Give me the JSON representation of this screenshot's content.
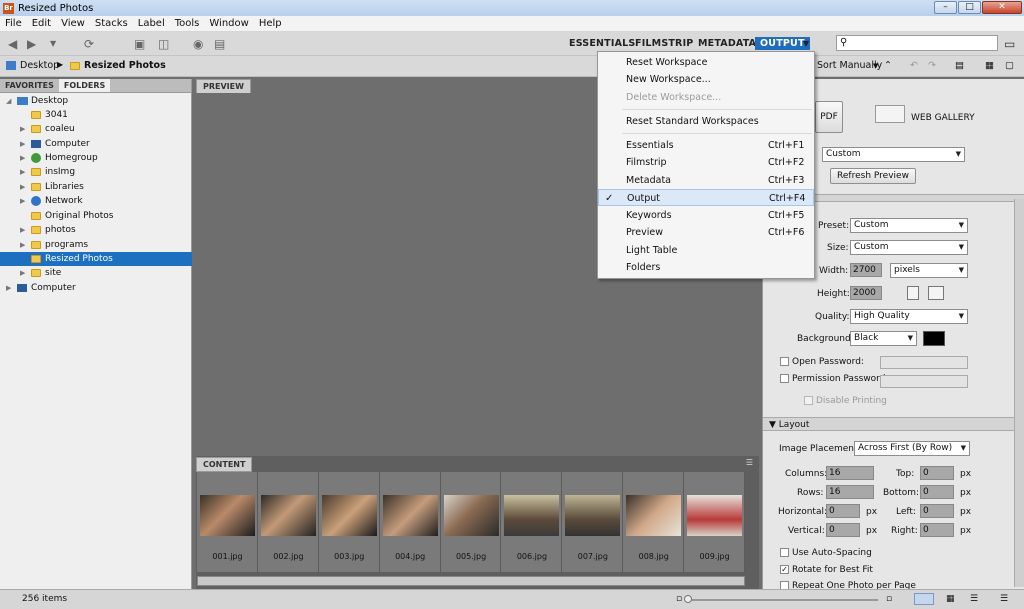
{
  "window": {
    "title": "Resized Photos",
    "app_badge": "Br",
    "controls": {
      "minimize": "–",
      "maximize": "□",
      "close": "✕"
    }
  },
  "menubar": [
    "File",
    "Edit",
    "View",
    "Stacks",
    "Label",
    "Tools",
    "Window",
    "Help"
  ],
  "workspaces": {
    "essentials": "ESSENTIALS",
    "filmstrip": "FILMSTRIP",
    "metadata": "METADATA",
    "output": "OUTPUT"
  },
  "search": {
    "placeholder": ""
  },
  "breadcrumb": {
    "root": "Desktop",
    "current": "Resized Photos"
  },
  "sort": {
    "label": "Sort Manually"
  },
  "left_tabs": {
    "favorites": "FAVORITES",
    "folders": "FOLDERS"
  },
  "folders": [
    {
      "label": "Desktop"
    },
    {
      "label": "3041"
    },
    {
      "label": "coaleu"
    },
    {
      "label": "Computer"
    },
    {
      "label": "Homegroup"
    },
    {
      "label": "insImg"
    },
    {
      "label": "Libraries"
    },
    {
      "label": "Network"
    },
    {
      "label": "Original Photos"
    },
    {
      "label": "photos"
    },
    {
      "label": "programs"
    },
    {
      "label": "Resized Photos"
    },
    {
      "label": "site"
    },
    {
      "label": "Computer"
    }
  ],
  "preview_tab": "PREVIEW",
  "content_tab": "CONTENT",
  "thumbnails": [
    "001.jpg",
    "002.jpg",
    "003.jpg",
    "004.jpg",
    "005.jpg",
    "006.jpg",
    "007.jpg",
    "008.jpg",
    "009.jpg"
  ],
  "status": {
    "items": "256 items"
  },
  "workspace_menu": {
    "items": [
      {
        "label": "Reset Workspace",
        "shortcut": ""
      },
      {
        "label": "New Workspace...",
        "shortcut": ""
      },
      {
        "label": "Delete Workspace...",
        "shortcut": ""
      },
      {
        "label": "Reset Standard Workspaces",
        "shortcut": ""
      },
      {
        "label": "Essentials",
        "shortcut": "Ctrl+F1"
      },
      {
        "label": "Filmstrip",
        "shortcut": "Ctrl+F2"
      },
      {
        "label": "Metadata",
        "shortcut": "Ctrl+F3"
      },
      {
        "label": "Output",
        "shortcut": "Ctrl+F4"
      },
      {
        "label": "Keywords",
        "shortcut": "Ctrl+F5"
      },
      {
        "label": "Preview",
        "shortcut": "Ctrl+F6"
      },
      {
        "label": "Light Table",
        "shortcut": ""
      },
      {
        "label": "Folders",
        "shortcut": ""
      }
    ],
    "checkmark": "✓"
  },
  "output": {
    "pdf": "PDF",
    "web_gallery": "WEB GALLERY",
    "template": "Custom",
    "refresh": "Refresh Preview",
    "preset_label": "Preset:",
    "preset": "Custom",
    "size_label": "Size:",
    "size": "Custom",
    "width_label": "Width:",
    "width": "2700",
    "unit": "pixels",
    "height_label": "Height:",
    "height": "2000",
    "quality_label": "Quality:",
    "quality": "High Quality",
    "background_label": "Background:",
    "background": "Black",
    "open_password": "Open Password:",
    "permission_password": "Permission Password:",
    "disable_printing": "Disable Printing",
    "layout_section": "Layout",
    "image_placement_label": "Image Placement:",
    "image_placement": "Across First (By Row)",
    "columns_label": "Columns:",
    "columns": "16",
    "rows_label": "Rows:",
    "rows": "16",
    "horizontal_label": "Horizontal:",
    "horizontal": "0",
    "vertical_label": "Vertical:",
    "vertical": "0",
    "top_label": "Top:",
    "top": "0",
    "bottom_label": "Bottom:",
    "bottom": "0",
    "left_label": "Left:",
    "left": "0",
    "right_label": "Right:",
    "right": "0",
    "px": "px",
    "auto_spacing": "Use Auto-Spacing",
    "rotate": "Rotate for Best Fit",
    "repeat": "Repeat One Photo per Page"
  },
  "colors": {
    "accent": "#1f6ebd",
    "selection": "#1d6fc0",
    "panel_bg": "#6e6e6e"
  }
}
